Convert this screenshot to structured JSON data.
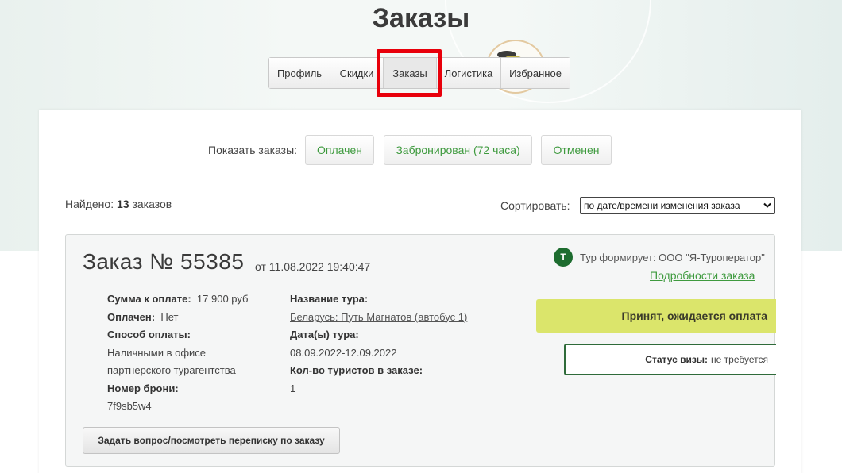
{
  "header": {
    "title": "Заказы",
    "tabs": [
      "Профиль",
      "Скидки",
      "Заказы",
      "Логистика",
      "Избранное"
    ],
    "active_tab": "Заказы"
  },
  "filter": {
    "label": "Показать заказы:",
    "buttons": [
      "Оплачен",
      "Забронирован (72 часа)",
      "Отменен"
    ]
  },
  "summary": {
    "found_prefix": "Найдено:",
    "found_count": "13",
    "found_suffix": "заказов",
    "sort_label": "Сортировать:",
    "sort_value": "по дате/времени изменения заказа"
  },
  "order": {
    "number": "Заказ № 55385",
    "date": "от 11.08.2022 19:40:47",
    "amount_label": "Сумма к оплате:",
    "amount_value": "17 900 руб",
    "paid_label": "Оплачен:",
    "paid_value": "Нет",
    "payment_method_label": "Способ оплаты:",
    "payment_method_line1": "Наличными в офисе",
    "payment_method_line2": "партнерского турагентства",
    "booking_label": "Номер брони:",
    "booking_value": "7f9sb5w4",
    "tour_name_label": "Название тура:",
    "tour_name_value": "Беларусь: Путь Магнатов (автобус 1)",
    "tour_dates_label": "Дата(ы) тура:",
    "tour_dates_value": "08.09.2022-12.09.2022",
    "tourists_label": "Кол-во туристов в заказе:",
    "tourists_value": "1",
    "operator_badge": "T",
    "operator_text": "Тур формирует: ООО \"Я-Туроператор\"",
    "details_link": "Подробности заказа",
    "status": "Принят, ожидается оплата",
    "visa_label": "Статус визы:",
    "visa_value": "не требуется",
    "ask_button": "Задать вопрос/посмотреть переписку по заказу"
  },
  "colors": {
    "accent_green": "#3e9a3e",
    "status_yellow": "#dbe56b",
    "dark_green": "#1d6c2f",
    "highlight_red": "#e8000b"
  }
}
